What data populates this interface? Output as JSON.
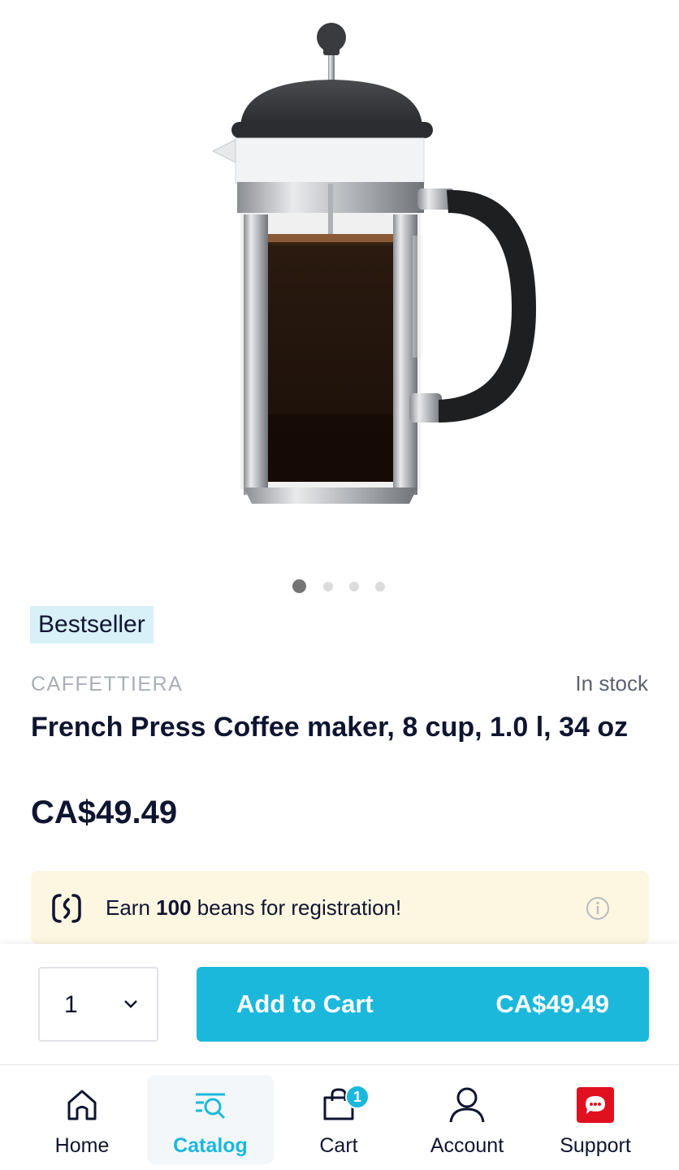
{
  "product": {
    "badge": "Bestseller",
    "brand": "CAFFETTIERA",
    "stock": "In stock",
    "title": "French Press Coffee maker, 8 cup, 1.0 l, 34 oz",
    "price": "CA$49.49",
    "image_slides": 4,
    "active_slide": 1
  },
  "promo": {
    "text_before": "Earn ",
    "amount": "100",
    "text_after": " beans for registration!"
  },
  "cart_bar": {
    "quantity": "1",
    "add_label": "Add to Cart",
    "add_amount": "CA$49.49"
  },
  "nav": {
    "items": [
      {
        "label": "Home",
        "icon": "home-icon"
      },
      {
        "label": "Catalog",
        "icon": "catalog-search-icon",
        "active": true
      },
      {
        "label": "Cart",
        "icon": "shopping-bag-icon",
        "badge": "1"
      },
      {
        "label": "Account",
        "icon": "user-icon"
      },
      {
        "label": "Support",
        "icon": "chat-bubble-icon"
      }
    ]
  },
  "colors": {
    "accent": "#1cb8dc",
    "badge_bg": "#d8f0f8",
    "promo_bg": "#fdf6e1",
    "support_red": "#e0101e",
    "text": "#0f1530"
  }
}
